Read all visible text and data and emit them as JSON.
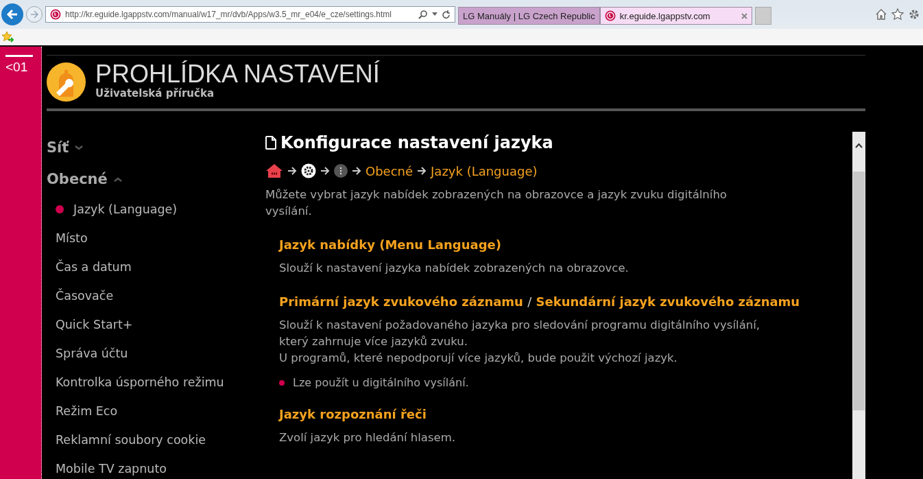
{
  "browser": {
    "address": "http://kr.eguide.lgappstv.com/manual/w17_mr/dvb/Apps/w3.5_mr_e04/e_cze/settings.html",
    "tabs": [
      {
        "label": "LG Manuály | LG Czech Republic",
        "selected": false
      },
      {
        "label": "kr.eguide.lgappstv.com",
        "selected": true
      }
    ]
  },
  "side_strip": {
    "label": "<01"
  },
  "header": {
    "title": "PROHLÍDKA NASTAVENÍ",
    "subtitle": "Uživatelská příručka"
  },
  "sidebar": {
    "sections": [
      {
        "label": "Síť",
        "expanded": false
      },
      {
        "label": "Obecné",
        "expanded": true,
        "items": [
          {
            "label": "Jazyk (Language)",
            "selected": true
          },
          {
            "label": "Místo",
            "selected": false
          },
          {
            "label": "Čas a datum",
            "selected": false
          },
          {
            "label": "Časovače",
            "selected": false
          },
          {
            "label": "Quick Start+",
            "selected": false
          },
          {
            "label": "Správa účtu",
            "selected": false
          },
          {
            "label": "Kontrolka úsporného režimu",
            "selected": false
          },
          {
            "label": "Režim Eco",
            "selected": false
          },
          {
            "label": "Reklamní soubory cookie",
            "selected": false
          },
          {
            "label": "Mobile TV zapnuto",
            "selected": false
          }
        ]
      }
    ]
  },
  "article": {
    "title": "Konfigurace nastavení jazyka",
    "breadcrumb": [
      "Obecné",
      "Jazyk (Language)"
    ],
    "intro": "Můžete vybrat jazyk nabídek zobrazených na obrazovce a jazyk zvuku digitálního vysílání.",
    "sections": [
      {
        "heading": [
          "Jazyk nabídky (Menu Language)"
        ],
        "paragraphs": [
          "Slouží k nastavení jazyka nabídek zobrazených na obrazovce."
        ]
      },
      {
        "heading": [
          "Primární jazyk zvukového záznamu",
          "/",
          "Sekundární jazyk zvukového záznamu"
        ],
        "paragraphs": [
          "Slouží k nastavení požadovaného jazyka pro sledování programu digitálního vysílání, který zahrnuje více jazyků zvuku.",
          "U programů, které nepodporují více jazyků, bude použit výchozí jazyk."
        ],
        "bullets": [
          "Lze použít u digitálního vysílání."
        ]
      },
      {
        "heading": [
          "Jazyk rozpoznání řeči"
        ],
        "paragraphs": [
          "Zvolí jazyk pro hledání hlasem."
        ]
      }
    ]
  }
}
